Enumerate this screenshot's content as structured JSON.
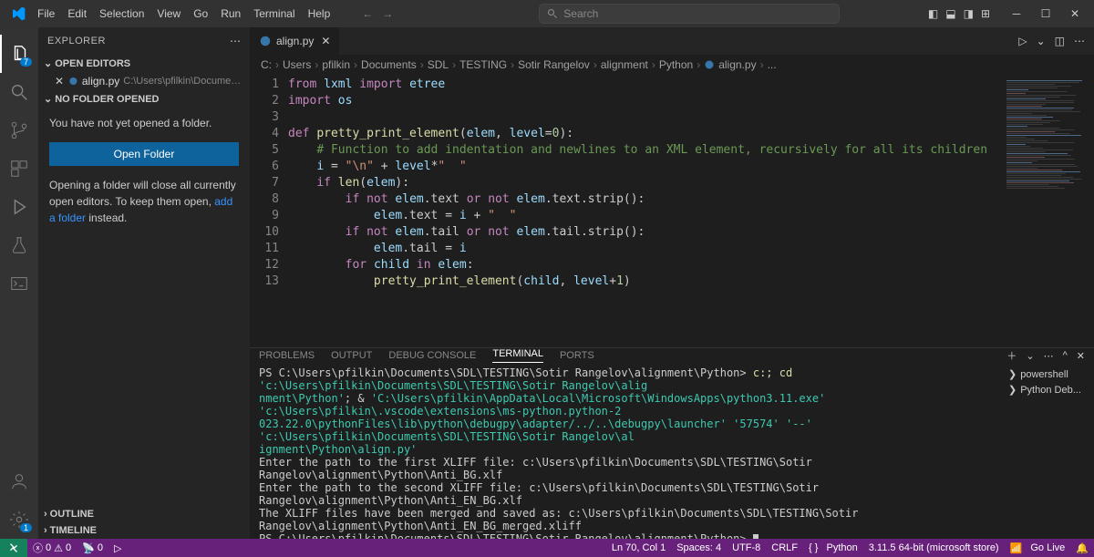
{
  "menu": [
    "File",
    "Edit",
    "Selection",
    "View",
    "Go",
    "Run",
    "Terminal",
    "Help"
  ],
  "search_placeholder": "Search",
  "explorer": {
    "title": "EXPLORER",
    "open_editors": "OPEN EDITORS",
    "no_folder": "NO FOLDER OPENED",
    "file_name": "align.py",
    "file_path": "C:\\Users\\pfilkin\\Documents\\SDL\\...",
    "msg1": "You have not yet opened a folder.",
    "open_folder_btn": "Open Folder",
    "msg2a": "Opening a folder will close all currently open editors. To keep them open, ",
    "msg2_link": "add a folder",
    "msg2b": " instead.",
    "outline": "OUTLINE",
    "timeline": "TIMELINE"
  },
  "tab": {
    "name": "align.py"
  },
  "breadcrumb": [
    "C:",
    "Users",
    "pfilkin",
    "Documents",
    "SDL",
    "TESTING",
    "Sotir Rangelov",
    "alignment",
    "Python",
    "align.py",
    "..."
  ],
  "code_lines": [
    {
      "n": 1,
      "html": "<span class='kw'>from</span> <span class='id'>lxml</span> <span class='kw'>import</span> <span class='id'>etree</span>"
    },
    {
      "n": 2,
      "html": "<span class='kw'>import</span> <span class='id'>os</span>"
    },
    {
      "n": 3,
      "html": ""
    },
    {
      "n": 4,
      "html": "<span class='kw'>def</span> <span class='fn2'>pretty_print_element</span>(<span class='id'>elem</span>, <span class='id'>level</span>=<span class='num'>0</span>):"
    },
    {
      "n": 5,
      "html": "    <span class='cm'># Function to add indentation and newlines to an XML element, recursively for all its children</span>"
    },
    {
      "n": 6,
      "html": "    <span class='id'>i</span> = <span class='str'>\"\\n\"</span> + <span class='id'>level</span>*<span class='str'>\"  \"</span>"
    },
    {
      "n": 7,
      "html": "    <span class='kw'>if</span> <span class='fn2'>len</span>(<span class='id'>elem</span>):"
    },
    {
      "n": 8,
      "html": "        <span class='kw'>if</span> <span class='kw'>not</span> <span class='id'>elem</span>.text <span class='kw'>or</span> <span class='kw'>not</span> <span class='id'>elem</span>.text.strip():"
    },
    {
      "n": 9,
      "html": "            <span class='id'>elem</span>.text = <span class='id'>i</span> + <span class='str'>\"  \"</span>"
    },
    {
      "n": 10,
      "html": "        <span class='kw'>if</span> <span class='kw'>not</span> <span class='id'>elem</span>.tail <span class='kw'>or</span> <span class='kw'>not</span> <span class='id'>elem</span>.tail.strip():"
    },
    {
      "n": 11,
      "html": "            <span class='id'>elem</span>.tail = <span class='id'>i</span>"
    },
    {
      "n": 12,
      "html": "        <span class='kw'>for</span> <span class='id'>child</span> <span class='kw'>in</span> <span class='id'>elem</span>:"
    },
    {
      "n": 13,
      "html": "            <span class='fn2'>pretty_print_element</span>(<span class='id'>child</span>, <span class='id'>level</span>+<span class='num'>1</span>)"
    }
  ],
  "panel": {
    "tabs": [
      "PROBLEMS",
      "OUTPUT",
      "DEBUG CONSOLE",
      "TERMINAL",
      "PORTS"
    ],
    "active": "TERMINAL",
    "side": [
      {
        "icon": "terminal",
        "label": "powershell"
      },
      {
        "icon": "python",
        "label": "Python Deb..."
      }
    ],
    "term_lines": [
      {
        "cls": "",
        "frag": [
          {
            "c": "term-white",
            "t": "PS C:\\Users\\pfilkin\\Documents\\SDL\\TESTING\\Sotir Rangelov\\alignment\\Python>  "
          },
          {
            "c": "term-yellow",
            "t": "c:; cd "
          },
          {
            "c": "term-cyan",
            "t": "'c:\\Users\\pfilkin\\Documents\\SDL\\TESTING\\Sotir Rangelov\\alig"
          }
        ]
      },
      {
        "cls": "",
        "frag": [
          {
            "c": "term-cyan",
            "t": "nment\\Python'"
          },
          {
            "c": "term-white",
            "t": "; & "
          },
          {
            "c": "term-cyan",
            "t": "'C:\\Users\\pfilkin\\AppData\\Local\\Microsoft\\WindowsApps\\python3.11.exe' 'c:\\Users\\pfilkin\\.vscode\\extensions\\ms-python.python-2"
          }
        ]
      },
      {
        "cls": "",
        "frag": [
          {
            "c": "term-cyan",
            "t": "023.22.0\\pythonFiles\\lib\\python\\debugpy\\adapter/../..\\debugpy\\launcher' '57574' '--' 'c:\\Users\\pfilkin\\Documents\\SDL\\TESTING\\Sotir Rangelov\\al"
          }
        ]
      },
      {
        "cls": "",
        "frag": [
          {
            "c": "term-cyan",
            "t": "ignment\\Python\\align.py'"
          }
        ]
      },
      {
        "cls": "",
        "frag": [
          {
            "c": "term-white",
            "t": "Enter the path to the first XLIFF file: c:\\Users\\pfilkin\\Documents\\SDL\\TESTING\\Sotir Rangelov\\alignment\\Python\\Anti_BG.xlf"
          }
        ]
      },
      {
        "cls": "",
        "frag": [
          {
            "c": "term-white",
            "t": "Enter the path to the second XLIFF file: c:\\Users\\pfilkin\\Documents\\SDL\\TESTING\\Sotir Rangelov\\alignment\\Python\\Anti_EN_BG.xlf"
          }
        ]
      },
      {
        "cls": "",
        "frag": [
          {
            "c": "term-white",
            "t": "The XLIFF files have been merged and saved as: c:\\Users\\pfilkin\\Documents\\SDL\\TESTING\\Sotir Rangelov\\alignment\\Python\\Anti_EN_BG_merged.xliff"
          }
        ]
      },
      {
        "cls": "",
        "frag": [
          {
            "c": "term-white",
            "t": "PS C:\\Users\\pfilkin\\Documents\\SDL\\TESTING\\Sotir Rangelov\\alignment\\Python> "
          },
          {
            "c": "cursor",
            "t": ""
          }
        ]
      }
    ]
  },
  "status": {
    "errors": "0",
    "warnings": "0",
    "ports": "0",
    "lncol": "Ln 70, Col 1",
    "spaces": "Spaces: 4",
    "enc": "UTF-8",
    "eol": "CRLF",
    "lang": "Python",
    "interp": "3.11.5 64-bit (microsoft store)",
    "golive": "Go Live"
  },
  "activity_badges": {
    "explorer": "7",
    "settings": "1"
  }
}
